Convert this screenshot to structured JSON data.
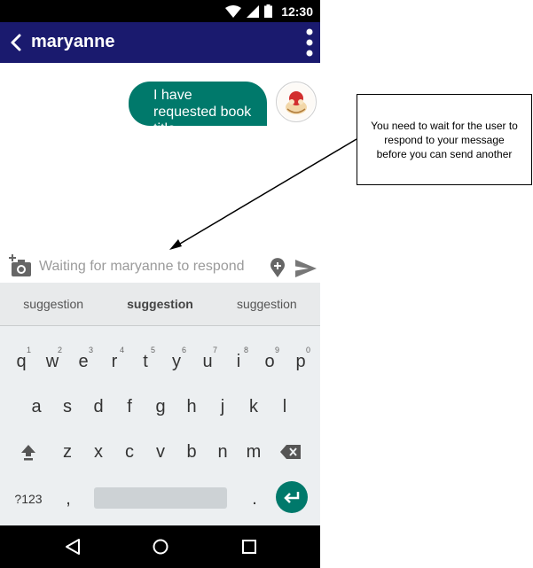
{
  "status_bar": {
    "time": "12:30"
  },
  "app_bar": {
    "contact_name": "maryanne"
  },
  "messages": [
    {
      "text": "I have requested book title",
      "sender": "me"
    }
  ],
  "composer": {
    "placeholder": "Waiting for maryanne to respond"
  },
  "suggestions": [
    "suggestion",
    "suggestion",
    "suggestion"
  ],
  "keyboard": {
    "row1": [
      {
        "k": "q",
        "n": "1"
      },
      {
        "k": "w",
        "n": "2"
      },
      {
        "k": "e",
        "n": "3"
      },
      {
        "k": "r",
        "n": "4"
      },
      {
        "k": "t",
        "n": "5"
      },
      {
        "k": "y",
        "n": "6"
      },
      {
        "k": "u",
        "n": "7"
      },
      {
        "k": "i",
        "n": "8"
      },
      {
        "k": "o",
        "n": "9"
      },
      {
        "k": "p",
        "n": "0"
      }
    ],
    "row2": [
      "a",
      "s",
      "d",
      "f",
      "g",
      "h",
      "j",
      "k",
      "l"
    ],
    "row3": [
      "z",
      "x",
      "c",
      "v",
      "b",
      "n",
      "m"
    ],
    "symbols_label": "?123",
    "comma": ",",
    "period": "."
  },
  "annotation": {
    "text": "You need to wait for the user to respond to your message before you can send another"
  },
  "colors": {
    "app_bar": "#1a1a6e",
    "accent": "#00796b",
    "keyboard_bg": "#eceff1"
  },
  "icons": [
    "back-arrow",
    "overflow-menu",
    "add-photo",
    "location",
    "send",
    "shift",
    "backspace",
    "enter",
    "nav-back",
    "nav-home",
    "nav-recents",
    "wifi",
    "signal",
    "battery"
  ]
}
